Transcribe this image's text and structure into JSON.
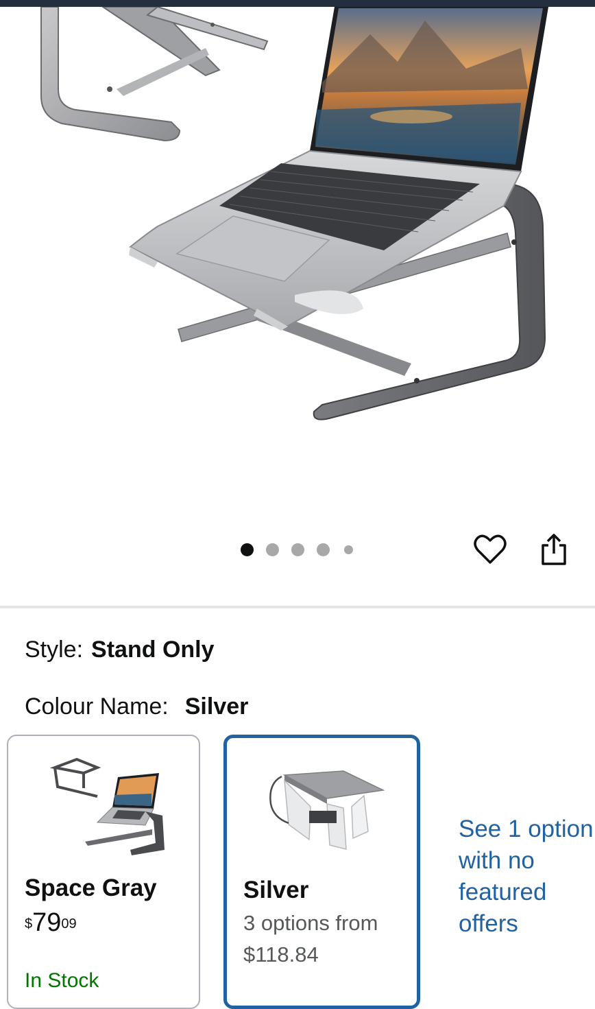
{
  "colors": {
    "accent_blue": "#2162a1",
    "in_stock_green": "#007600",
    "secondary_text": "#565959",
    "divider": "#e3e6e6"
  },
  "gallery": {
    "image_count": 5,
    "active_index": 0,
    "wishlist_icon": "heart-icon",
    "share_icon": "share-icon"
  },
  "variations": {
    "style_label": "Style:",
    "style_value": "Stand Only",
    "colour_label": "Colour Name:",
    "colour_value": "Silver"
  },
  "swatches": [
    {
      "name": "Space Gray",
      "price_symbol": "$",
      "price_whole": "79",
      "price_fraction": "09",
      "availability": "In Stock"
    },
    {
      "name": "Silver",
      "options_line": "3 options from",
      "options_price": "$118.84"
    }
  ],
  "see_more": {
    "text": "See 1 option with no featured offers"
  }
}
